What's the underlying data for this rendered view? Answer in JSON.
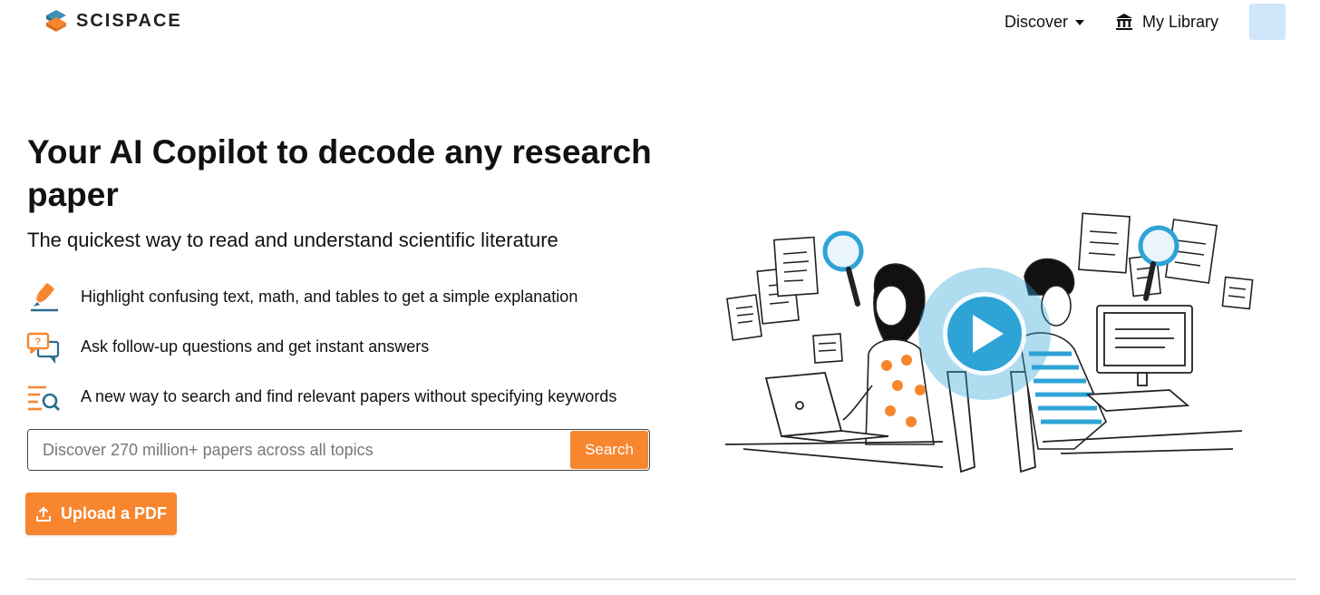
{
  "header": {
    "logo_text": "SCISPACE",
    "nav": {
      "discover_label": "Discover",
      "library_label": "My Library"
    }
  },
  "hero": {
    "title": "Your AI Copilot to decode any research paper",
    "subtitle": "The quickest way to read and understand scientific literature",
    "features": [
      {
        "icon": "highlighter-icon",
        "text": "Highlight confusing text, math, and tables to get a simple explanation"
      },
      {
        "icon": "chat-question-icon",
        "text": "Ask follow-up questions and get instant answers"
      },
      {
        "icon": "search-list-icon",
        "text": "A new way to search and find relevant papers without specifying keywords"
      }
    ]
  },
  "search": {
    "placeholder": "Discover 270 million+ papers across all topics",
    "button_label": "Search"
  },
  "upload": {
    "label": "Upload a PDF"
  },
  "colors": {
    "accent": "#f7862f",
    "video_blue": "#2ea3d6",
    "avatar_bg": "#cfe6fb"
  }
}
